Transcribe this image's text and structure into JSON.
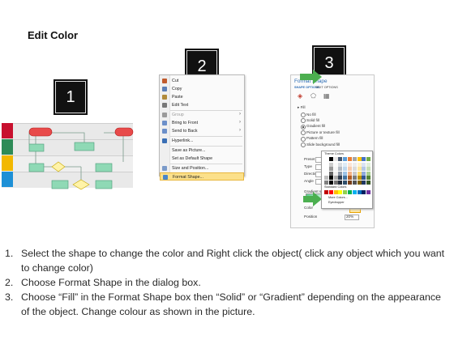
{
  "slide": {
    "title": "Edit Color"
  },
  "badges": [
    "1",
    "2",
    "3"
  ],
  "context_menu": {
    "items": [
      {
        "label": "Cut",
        "icon": "scissors-icon",
        "color": "#c05a2c"
      },
      {
        "label": "Copy",
        "icon": "copy-icon",
        "color": "#5b7fb8"
      },
      {
        "label": "Paste",
        "icon": "paste-icon",
        "color": "#b08a3a"
      },
      {
        "label": "Edit Text",
        "icon": "edit-text-icon",
        "color": "#777777"
      },
      {
        "label": "Group",
        "icon": "group-icon",
        "color": "#9a9a9a",
        "disabled": true,
        "submenu": true
      },
      {
        "label": "Bring to Front",
        "icon": "bring-front-icon",
        "color": "#6b8fc9",
        "submenu": true
      },
      {
        "label": "Send to Back",
        "icon": "send-back-icon",
        "color": "#6b8fc9",
        "submenu": true
      },
      {
        "label": "Hyperlink...",
        "icon": "hyperlink-icon",
        "color": "#3a6fb5"
      },
      {
        "label": "Save as Picture...",
        "icon": "",
        "color": ""
      },
      {
        "label": "Set as Default Shape",
        "icon": "",
        "color": ""
      },
      {
        "label": "Size and Position...",
        "icon": "size-icon",
        "color": "#7a9ac9"
      },
      {
        "label": "Format Shape...",
        "icon": "format-shape-icon",
        "color": "#4a86c8",
        "selected": true
      }
    ]
  },
  "format_pane": {
    "title": "Format Shape",
    "tabs": [
      "SHAPE OPTIONS",
      "TEXT OPTIONS"
    ],
    "section": "Fill",
    "fill_options": [
      "No fill",
      "Solid fill",
      "Gradient fill",
      "Picture or texture fill",
      "Pattern fill",
      "Slide background fill"
    ],
    "labels": [
      "Preset gradi",
      "Type",
      "Direction",
      "Angle",
      "Gradient st",
      "Color",
      "Position"
    ],
    "position_value": "20%",
    "palette": {
      "theme_label": "Theme Colors",
      "standard_label": "Standard Colors",
      "more_colors": "More Colors...",
      "eyedropper": "Eyedropper"
    }
  },
  "instructions": [
    {
      "num": "1.",
      "text": "Select the shape to change the color and Right click the object( click any object which you want to change color)"
    },
    {
      "num": "2.",
      "text": "Choose Format Shape in the dialog box."
    },
    {
      "num": "3.",
      "text": "Choose “Fill” in the Format Shape box then “Solid” or “Gradient” depending on the appearance of the object. Change colour as shown in the picture."
    }
  ],
  "colors": {
    "arrow": "#4caf50",
    "lane_red": "#c8102e",
    "lane_green": "#2e8b57",
    "lane_yellow": "#f2b800",
    "lane_blue": "#1e90d6",
    "shape_red": "#e84a4a",
    "shape_green": "#8fd9b5",
    "shape_diamond": "#fff3a8",
    "menu_highlight": "#fbe08a"
  }
}
